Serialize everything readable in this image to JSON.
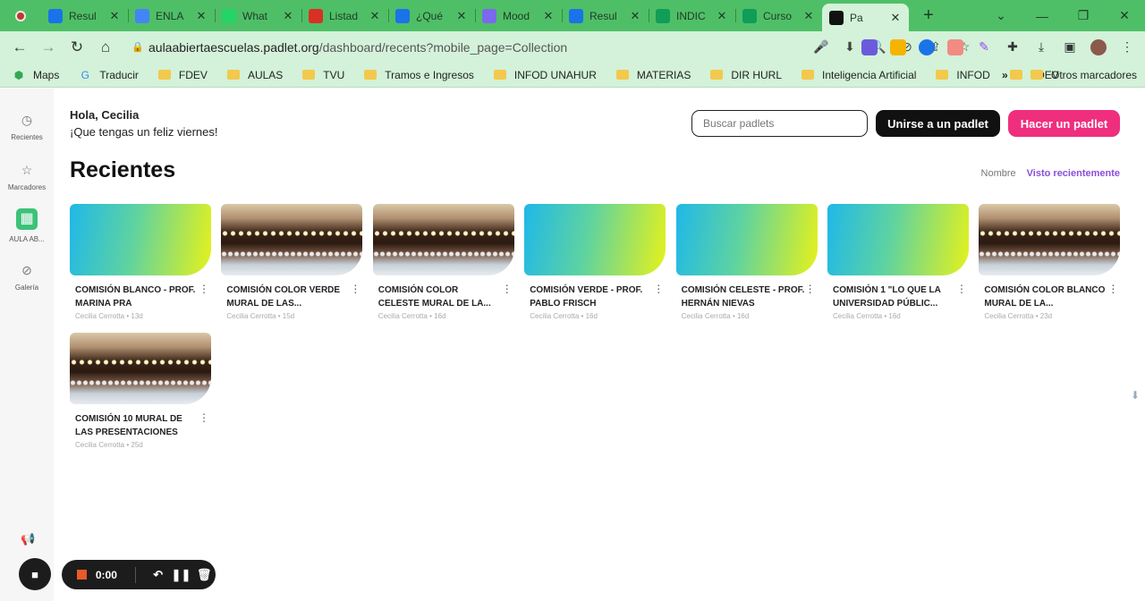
{
  "browser": {
    "tabs": [
      {
        "title": "Resul",
        "icon": "google-drive-icon",
        "color": "#1a73e8"
      },
      {
        "title": "ENLA",
        "icon": "google-docs-icon",
        "color": "#4285f4"
      },
      {
        "title": "What",
        "icon": "whatsapp-icon",
        "color": "#25d366"
      },
      {
        "title": "Listad",
        "icon": "gmail-icon",
        "color": "#d93025"
      },
      {
        "title": "¿Qué",
        "icon": "google-drive-icon",
        "color": "#1a73e8"
      },
      {
        "title": "Mood",
        "icon": "moodle-icon",
        "color": "#7b68ee"
      },
      {
        "title": "Resul",
        "icon": "google-drive-icon",
        "color": "#1a73e8"
      },
      {
        "title": "INDIC",
        "icon": "google-sheets-icon",
        "color": "#0f9d58"
      },
      {
        "title": "Curso",
        "icon": "google-sheets-icon",
        "color": "#0f9d58"
      },
      {
        "title": "Pa",
        "icon": "padlet-icon",
        "color": "#111111"
      }
    ],
    "url_domain": "aulaabiertaescuelas.padlet.org",
    "url_path": "/dashboard/recents?mobile_page=Collection",
    "bookmarks": [
      {
        "label": "Maps",
        "type": "maps"
      },
      {
        "label": "Traducir",
        "type": "translate"
      },
      {
        "label": "FDEV",
        "type": "folder"
      },
      {
        "label": "AULAS",
        "type": "folder"
      },
      {
        "label": "TVU",
        "type": "folder"
      },
      {
        "label": "Tramos e Ingresos",
        "type": "folder"
      },
      {
        "label": "INFOD UNAHUR",
        "type": "folder"
      },
      {
        "label": "MATERIAS",
        "type": "folder"
      },
      {
        "label": "DIR HURL",
        "type": "folder"
      },
      {
        "label": "Inteligencia Artificial",
        "type": "folder"
      },
      {
        "label": "INFOD",
        "type": "folder"
      },
      {
        "label": "FDEV",
        "type": "folder"
      }
    ],
    "bookmarks_more": "»",
    "other_bookmarks": "Otros marcadores"
  },
  "sidebar": {
    "items": [
      {
        "label": "Recientes",
        "icon": "clock-icon"
      },
      {
        "label": "Marcadores",
        "icon": "star-icon"
      },
      {
        "label": "AULA AB...",
        "icon": "grid-icon"
      },
      {
        "label": "Galería",
        "icon": "gallery-icon"
      }
    ]
  },
  "header": {
    "greeting": "Hola, Cecilia",
    "subgreeting": "¡Que tengas un feliz viernes!",
    "search_placeholder": "Buscar padlets",
    "join_button": "Unirse a un padlet",
    "make_button": "Hacer un padlet"
  },
  "section": {
    "title": "Recientes",
    "sort_name": "Nombre",
    "sort_recent": "Visto recientemente"
  },
  "padlets": [
    {
      "title": "COMISIÓN BLANCO - PROF. MARINA PRA",
      "meta": "Cecilia Cerrotta • 13d",
      "thumb": "gradient"
    },
    {
      "title": "COMISIÓN COLOR VERDE MURAL DE LAS...",
      "meta": "Cecilia Cerrotta • 15d",
      "thumb": "photo"
    },
    {
      "title": "COMISIÓN COLOR CELESTE MURAL DE LA...",
      "meta": "Cecilia Cerrotta • 16d",
      "thumb": "photo"
    },
    {
      "title": "COMISIÓN VERDE - PROF. PABLO FRISCH",
      "meta": "Cecilia Cerrotta • 16d",
      "thumb": "gradient"
    },
    {
      "title": "COMISIÓN CELESTE - PROF. HERNÁN NIEVAS",
      "meta": "Cecilia Cerrotta • 16d",
      "thumb": "gradient"
    },
    {
      "title": "COMISIÓN 1 \"LO QUE LA UNIVERSIDAD PÚBLIC...",
      "meta": "Cecilia Cerrotta • 16d",
      "thumb": "gradient"
    },
    {
      "title": "COMISIÓN COLOR BLANCO MURAL DE LA...",
      "meta": "Cecilia Cerrotta • 23d",
      "thumb": "photo"
    },
    {
      "title": "COMISIÓN 10 MURAL DE LAS PRESENTACIONES",
      "meta": "Cecilia Cerrotta • 25d",
      "thumb": "photo"
    }
  ],
  "recorder": {
    "time": "0:00"
  }
}
